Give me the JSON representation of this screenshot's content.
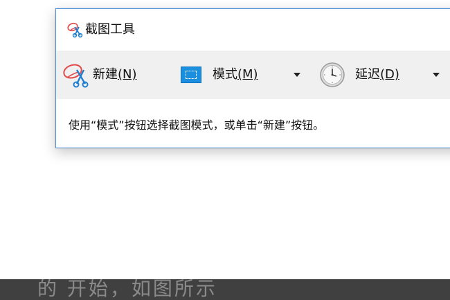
{
  "window": {
    "title": "截图工具"
  },
  "toolbar": {
    "new_label": "新建",
    "new_key": "(N)",
    "mode_label": "模式",
    "mode_key": "(M)",
    "delay_label": "延迟",
    "delay_key": "(D)"
  },
  "status": {
    "text": "使用“模式”按钮选择截图模式，或单击“新建”按钮。"
  },
  "bottom": {
    "text": "的 开始，如图所示"
  },
  "icons": {
    "title": "scissors-icon",
    "new": "scissors-icon",
    "mode": "rectangle-mode-icon",
    "delay": "clock-icon"
  },
  "colors": {
    "window_border": "#4a90d9",
    "toolbar_bg": "#f0f0f0",
    "mode_icon": "#1a8fe0",
    "bottom_bar": "#404040"
  }
}
